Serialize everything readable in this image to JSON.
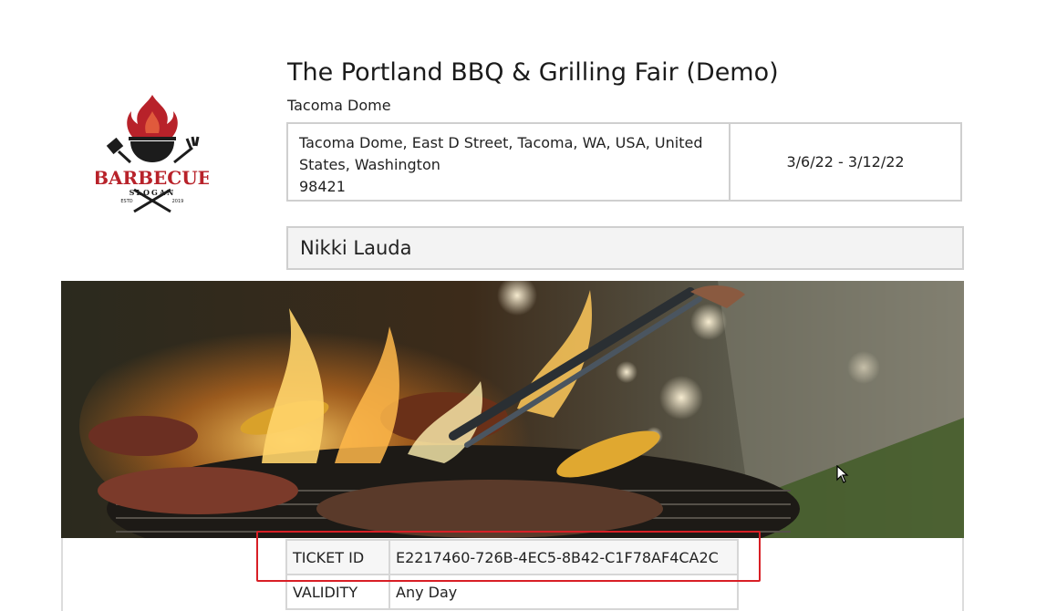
{
  "event": {
    "title": "The Portland BBQ & Grilling Fair (Demo)",
    "venue": "Tacoma Dome",
    "address_line1": "Tacoma Dome, East D Street, Tacoma, WA, USA, United",
    "address_line2": "States, Washington",
    "address_line3": "98421",
    "dates": "3/6/22 - 3/12/22"
  },
  "logo": {
    "name": "BARBECUE",
    "tagline": "SLOGAN",
    "estd": "ESTD",
    "year": "2019",
    "colors": {
      "red": "#b8222a",
      "dark": "#1c1c1c"
    }
  },
  "attendee": {
    "name": "Nikki Lauda"
  },
  "ticket": {
    "rows": [
      {
        "label": "TICKET ID",
        "value": "E2217460-726B-4EC5-8B42-C1F78AF4CA2C"
      },
      {
        "label": "VALIDITY",
        "value": "Any Day"
      }
    ],
    "highlight_color": "#d81f26"
  },
  "banner": {
    "icon": "grill-fire-photo"
  }
}
